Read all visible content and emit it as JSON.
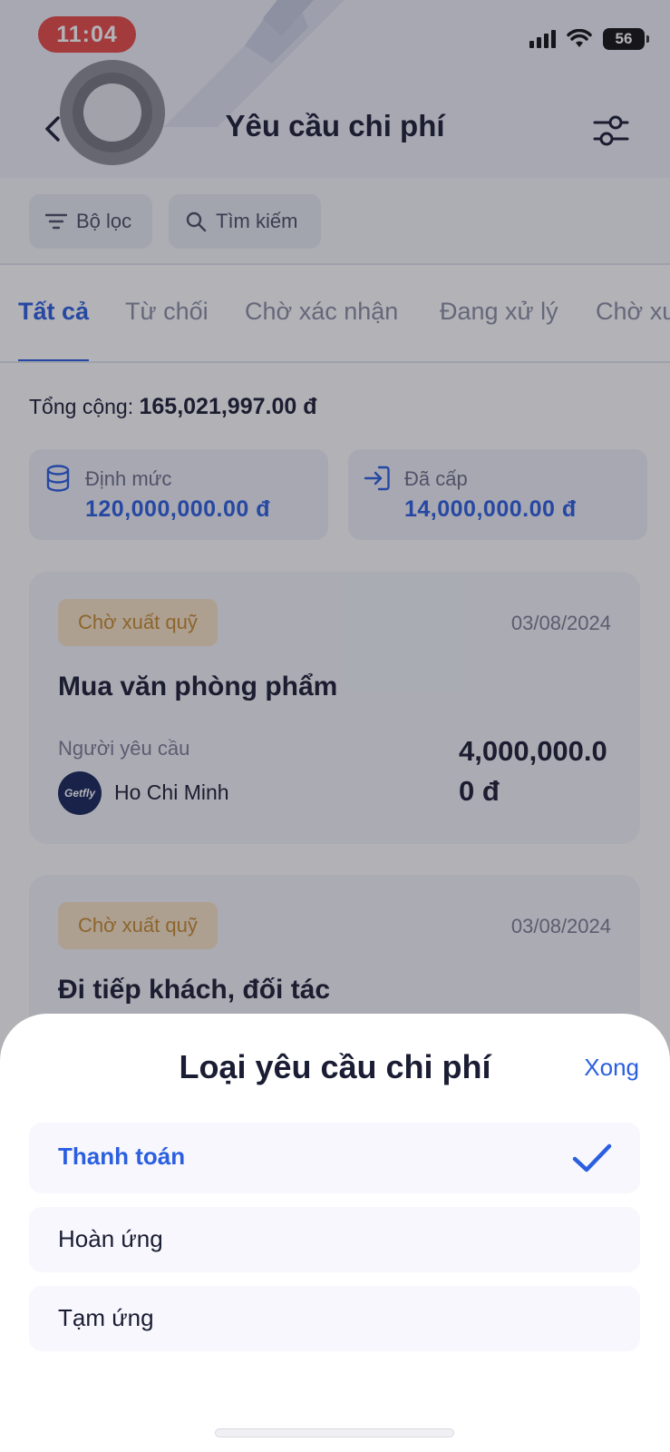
{
  "status_bar": {
    "time": "11:04",
    "battery": "56"
  },
  "header": {
    "title": "Yêu cầu chi phí"
  },
  "filters": {
    "filter_label": "Bộ lọc",
    "search_label": "Tìm kiếm"
  },
  "tabs": [
    {
      "label": "Tất cả",
      "active": true
    },
    {
      "label": "Từ chối"
    },
    {
      "label": "Chờ xác nhận"
    },
    {
      "label": "Đang xử lý"
    },
    {
      "label": "Chờ xu"
    }
  ],
  "summary": {
    "total_label": "Tổng cộng:",
    "total_value": "165,021,997.00 đ",
    "quota_label": "Định mức",
    "quota_value": "120,000,000.00 đ",
    "granted_label": "Đã cấp",
    "granted_value": "14,000,000.00 đ"
  },
  "requests": [
    {
      "status": "Chờ xuất quỹ",
      "date": "03/08/2024",
      "title": "Mua văn phòng phẩm",
      "requester_label": "Người yêu cầu",
      "avatar_text": "Getfly",
      "requester": "Ho Chi Minh",
      "amount": "4,000,000.00 đ"
    },
    {
      "status": "Chờ xuất quỹ",
      "date": "03/08/2024",
      "title": "Đi tiếp khách, đối tác"
    }
  ],
  "sheet": {
    "title": "Loại yêu cầu chi phí",
    "done_label": "Xong",
    "options": [
      {
        "label": "Thanh toán",
        "selected": true
      },
      {
        "label": "Hoàn ứng",
        "selected": false
      },
      {
        "label": "Tạm ứng",
        "selected": false
      }
    ]
  },
  "colors": {
    "accent": "#2b5fe0",
    "badge_bg": "#f8e4c6",
    "badge_text": "#c78a2c",
    "recording_pill": "#e84a45"
  },
  "icons": [
    "chevron-left-icon",
    "sliders-icon",
    "filter-icon",
    "search-icon",
    "database-icon",
    "sign-in-icon",
    "checkmark-icon"
  ]
}
